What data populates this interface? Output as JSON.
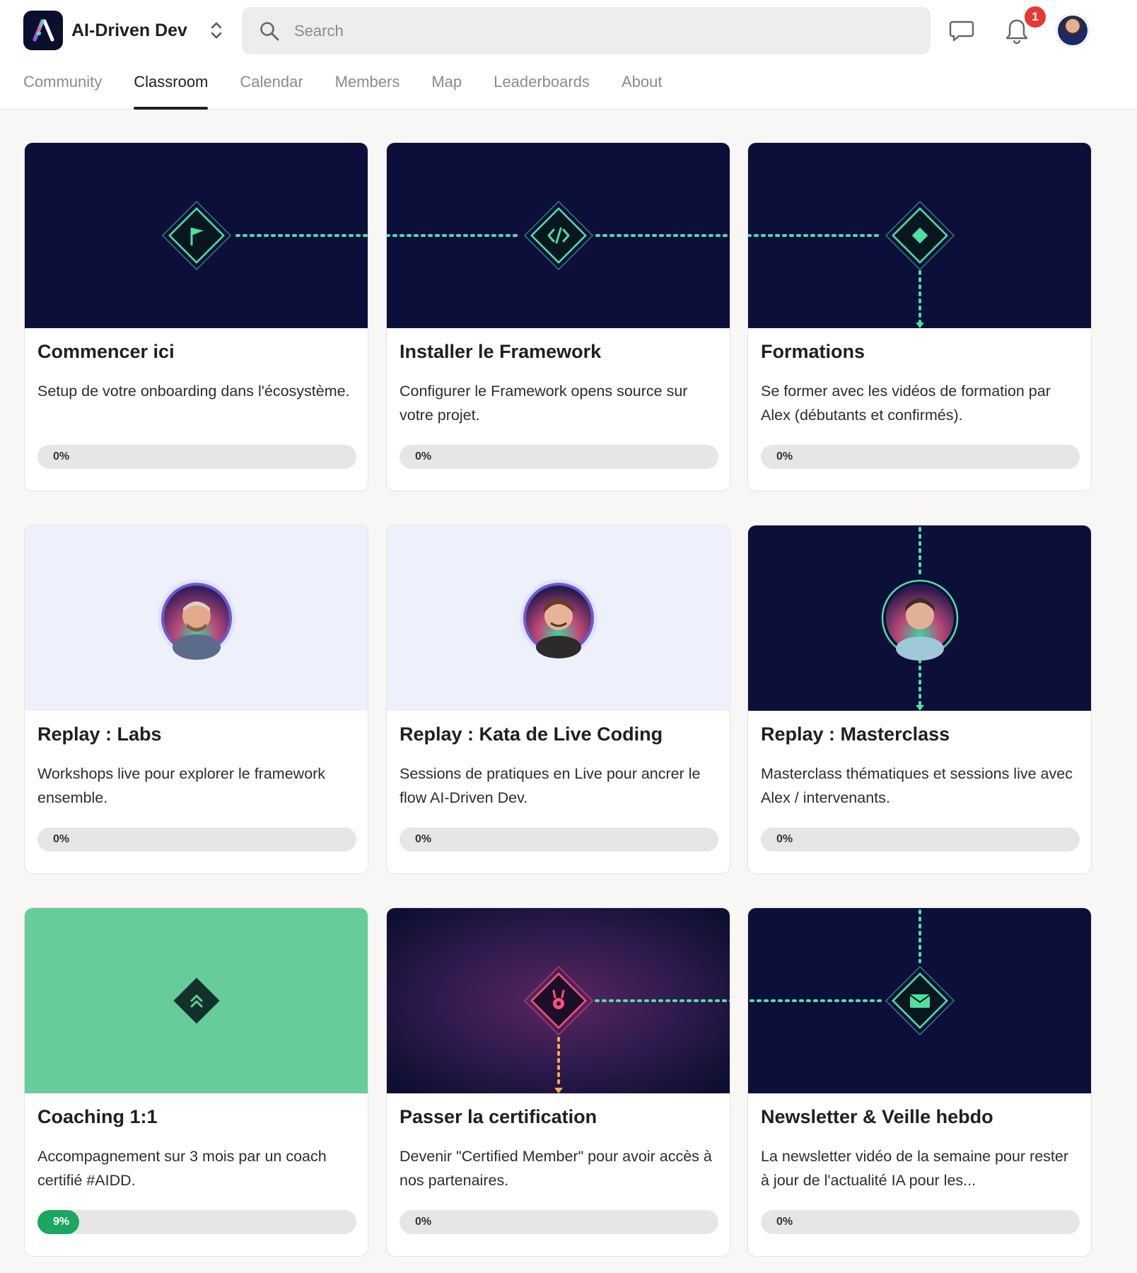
{
  "app": {
    "name": "AI-Driven Dev"
  },
  "search": {
    "placeholder": "Search"
  },
  "notifications": {
    "count": "1"
  },
  "tabs": [
    {
      "label": "Community",
      "active": false
    },
    {
      "label": "Classroom",
      "active": true
    },
    {
      "label": "Calendar",
      "active": false
    },
    {
      "label": "Members",
      "active": false
    },
    {
      "label": "Map",
      "active": false
    },
    {
      "label": "Leaderboards",
      "active": false
    },
    {
      "label": "About",
      "active": false
    }
  ],
  "colors": {
    "navy": "#0b0f3a",
    "green_accent": "#4ee0a0",
    "green_cover": "#66cc99",
    "lavender_cover": "#eef0fb",
    "progress_green": "#1aa760",
    "badge_red": "#e53935"
  },
  "courses": [
    {
      "title": "Commencer ici",
      "description": "Setup de votre onboarding dans l'écosystème.",
      "progress_label": "0%",
      "progress": 0,
      "cover_icon": "flag-icon"
    },
    {
      "title": "Installer le Framework",
      "description": "Configurer le Framework opens source sur votre projet.",
      "progress_label": "0%",
      "progress": 0,
      "cover_icon": "code-icon"
    },
    {
      "title": "Formations",
      "description": "Se former avec les vidéos de formation par Alex (débutants et confirmés).",
      "progress_label": "0%",
      "progress": 0,
      "cover_icon": "diamond-icon"
    },
    {
      "title": "Replay : Labs",
      "description": "Workshops live pour explorer le framework ensemble.",
      "progress_label": "0%",
      "progress": 0,
      "cover_icon": "host-photo"
    },
    {
      "title": "Replay : Kata de Live Coding",
      "description": "Sessions de pratiques en Live pour ancrer le flow AI-Driven Dev.",
      "progress_label": "0%",
      "progress": 0,
      "cover_icon": "host-photo"
    },
    {
      "title": "Replay : Masterclass",
      "description": "Masterclass thématiques et sessions live avec Alex / intervenants.",
      "progress_label": "0%",
      "progress": 0,
      "cover_icon": "host-photo"
    },
    {
      "title": "Coaching 1:1",
      "description": "Accompagnement sur 3 mois par un coach certifié #AIDD.",
      "progress_label": "9%",
      "progress": 9,
      "cover_icon": "chevrons-up-icon"
    },
    {
      "title": "Passer la certification",
      "description": "Devenir \"Certified Member\" pour avoir accès à nos partenaires.",
      "progress_label": "0%",
      "progress": 0,
      "cover_icon": "badge-icon"
    },
    {
      "title": "Newsletter & Veille hebdo",
      "description": "La newsletter vidéo de la semaine pour rester à jour de l'actualité IA pour les...",
      "progress_label": "0%",
      "progress": 0,
      "cover_icon": "envelope-icon"
    }
  ]
}
